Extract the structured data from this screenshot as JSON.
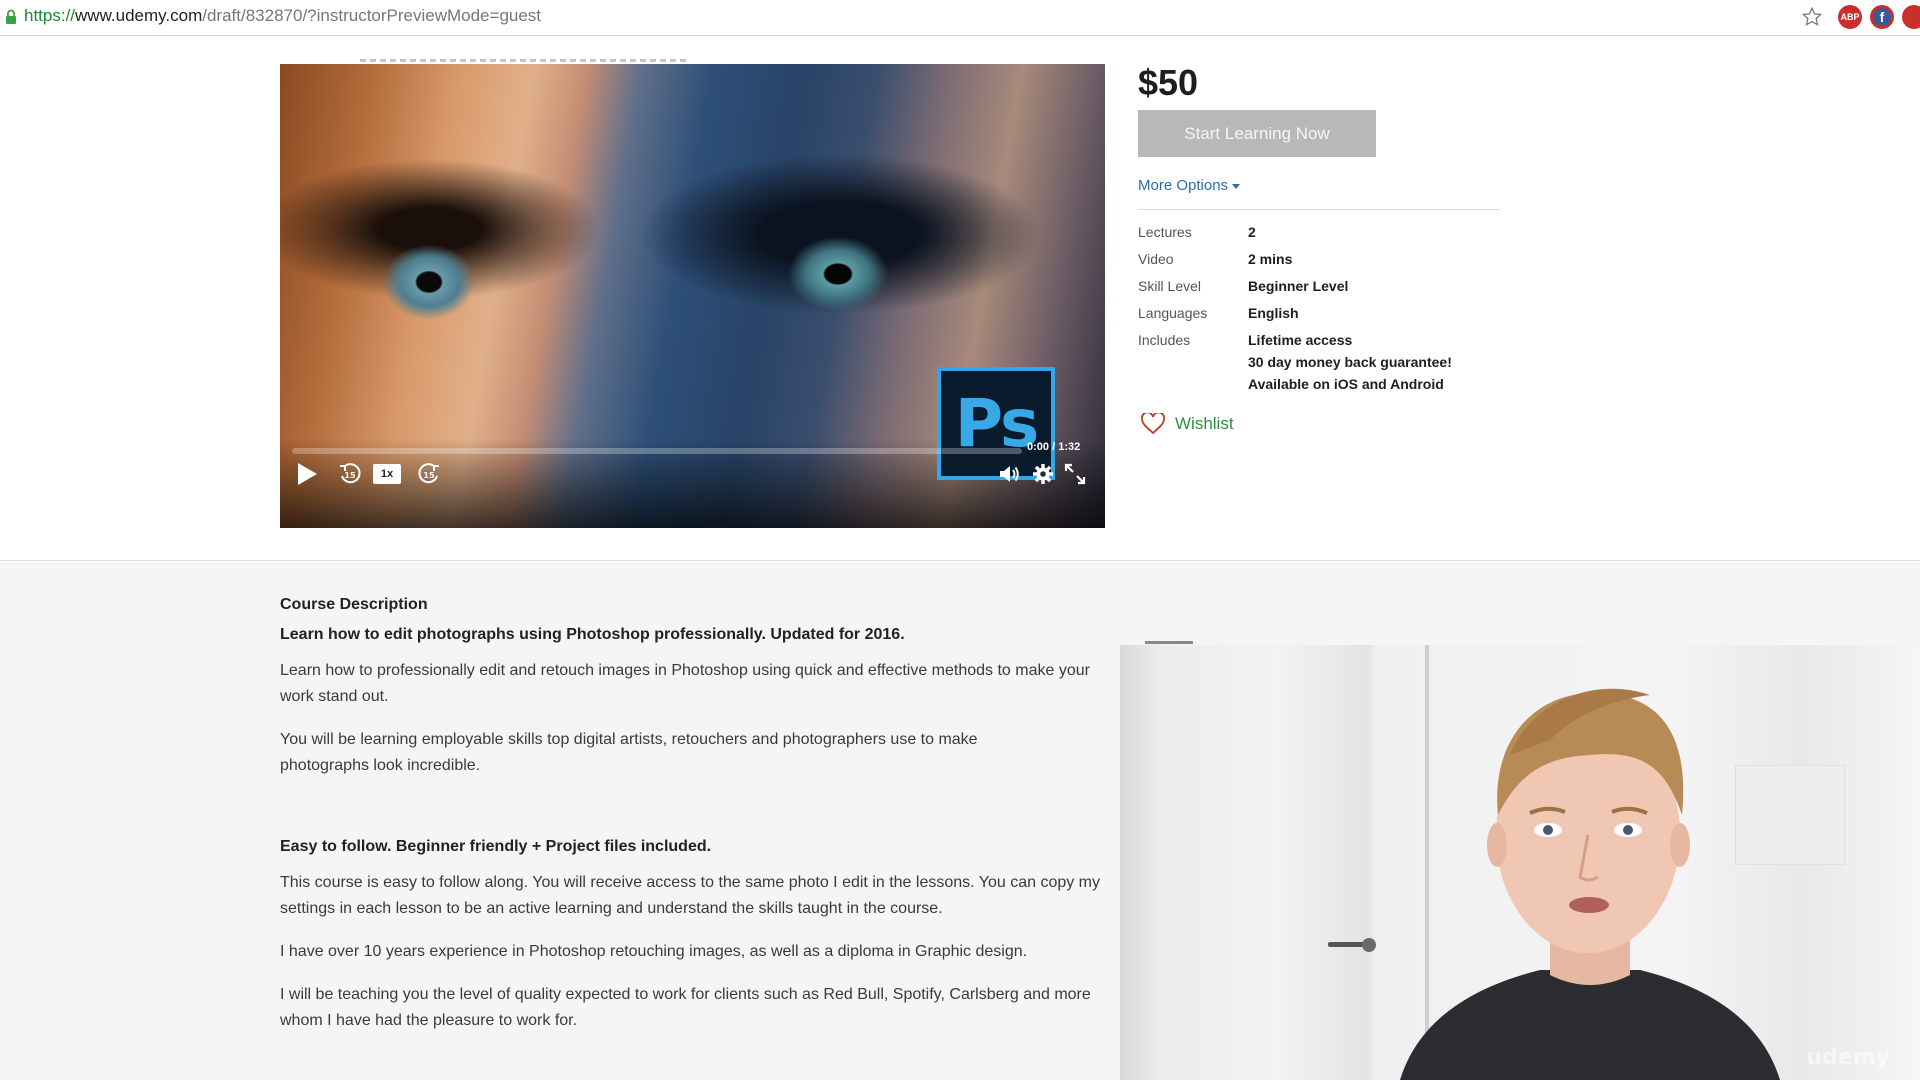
{
  "browser": {
    "url": {
      "protocol": "https://",
      "host": "www.udemy.com",
      "path": "/draft/832870/?instructorPreviewMode=guest"
    }
  },
  "video": {
    "current_time": "0:00",
    "duration": "1:32",
    "time_separator": "/",
    "speed": "1x",
    "progress_fraction": 0.0,
    "logo_text": "Ps"
  },
  "purchase": {
    "price": "$50",
    "start_button": "Start Learning Now",
    "more_options": "More Options",
    "specs": [
      {
        "label": "Lectures",
        "values": [
          "2"
        ]
      },
      {
        "label": "Video",
        "values": [
          "2 mins"
        ]
      },
      {
        "label": "Skill Level",
        "values": [
          "Beginner Level"
        ]
      },
      {
        "label": "Languages",
        "values": [
          "English"
        ]
      },
      {
        "label": "Includes",
        "values": [
          "Lifetime access",
          "30 day money back guarantee!",
          "Available on iOS and Android"
        ]
      }
    ],
    "wishlist": "Wishlist"
  },
  "description": {
    "heading": "Course Description",
    "intro_bold": "Learn how to edit photographs using Photoshop professionally. Updated for 2016.",
    "p1": "Learn how to professionally edit and retouch images in Photoshop using quick and effective methods to make your work stand out.",
    "p2": "You will be learning employable skills top digital artists, retouchers and photographers use to make photographs look incredible.",
    "sub_bold": "Easy to follow. Beginner friendly + Project files included.",
    "p3": "This course is easy to follow along. You will receive access to the same photo I edit in the lessons. You can copy my settings in each lesson to be an active learning and understand the skills taught in the course.",
    "p4": "I have over 10 years experience in Photoshop retouching images, as well as a diploma in Graphic design.",
    "p5": "I will be teaching you the level of quality expected to work for clients such as Red Bull, Spotify, Carlsberg and more whom I have had the pleasure to work for."
  },
  "webcam": {
    "watermark": "udemy"
  },
  "colors": {
    "link_blue": "#2a6fad",
    "wishlist_green": "#2f8f3b",
    "button_disabled": "#b8b8b8",
    "ps_blue": "#34a6e3"
  }
}
